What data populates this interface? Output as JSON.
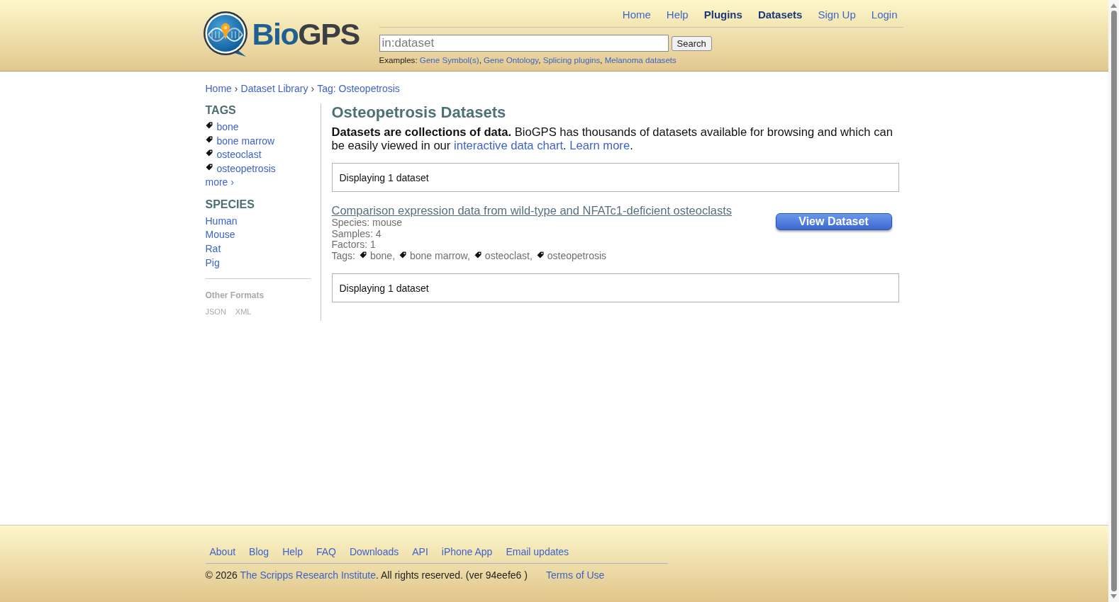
{
  "header": {
    "logo": {
      "parts": [
        {
          "text": "Bio",
          "kind": "accent"
        },
        {
          "text": "GPS",
          "kind": "plain"
        }
      ]
    },
    "nav": [
      {
        "label": "Home",
        "emphasized": false
      },
      {
        "label": "Help",
        "emphasized": false
      },
      {
        "label": "Plugins",
        "emphasized": true
      },
      {
        "label": "Datasets",
        "emphasized": true
      },
      {
        "label": "Sign Up",
        "emphasized": false
      },
      {
        "label": "Login",
        "emphasized": false
      }
    ],
    "search": {
      "placeholder": "in:dataset",
      "button": "Search"
    },
    "examples": {
      "label": "Examples:",
      "separator": ",",
      "links": [
        "Gene Symbol(s)",
        "Gene Ontology",
        "Splicing plugins",
        "Melanoma datasets"
      ]
    }
  },
  "breadcrumb": {
    "separator": "›",
    "items": [
      "Home",
      "Dataset Library",
      "Tag: Osteopetrosis"
    ]
  },
  "sidebar": {
    "sections": [
      {
        "kind": "tags",
        "heading": "TAGS",
        "items": [
          "bone",
          "bone marrow",
          "osteoclast",
          "osteopetrosis"
        ],
        "more": "more ›"
      },
      {
        "kind": "plain",
        "heading": "SPECIES",
        "items": [
          "Human",
          "Mouse",
          "Rat",
          "Pig"
        ]
      }
    ],
    "formats": {
      "heading": "Other Formats",
      "items": [
        "JSON",
        "XML"
      ]
    }
  },
  "main": {
    "title": "Osteopetrosis Datasets",
    "intro": [
      {
        "kind": "text",
        "text": "**Datasets are collections of data.** BioGPS has thousands of datasets available for browsing and which can be easily viewed in our "
      },
      {
        "kind": "link",
        "text": "interactive data chart"
      },
      {
        "kind": "text",
        "text": ". "
      },
      {
        "kind": "link",
        "text": "Learn more"
      },
      {
        "kind": "text",
        "text": "."
      }
    ],
    "summary_top": "Displaying 1 dataset",
    "datasets": [
      {
        "title": "Comparison expression data from wild-type and NFATc1-deficient osteoclasts",
        "meta": [
          "Species: mouse",
          "Samples: 4",
          "Factors: 1"
        ],
        "tags_label": "Tags:",
        "tag_separator": ",",
        "tags": [
          "bone",
          "bone marrow",
          "osteoclast",
          "osteopetrosis"
        ],
        "button": "View Dataset"
      }
    ],
    "summary_bottom": "Displaying 1 dataset"
  },
  "footer": {
    "links": [
      "About",
      "Blog",
      "Help",
      "FAQ",
      "Downloads",
      "API",
      "iPhone App",
      "Email updates"
    ],
    "copyright": [
      {
        "kind": "text",
        "text": "© 2026 "
      },
      {
        "kind": "link",
        "text": "The Scripps Research Institute"
      },
      {
        "kind": "text",
        "text": ". All rights reserved. (ver 94eefe6 )"
      }
    ],
    "terms": "Terms of Use"
  }
}
